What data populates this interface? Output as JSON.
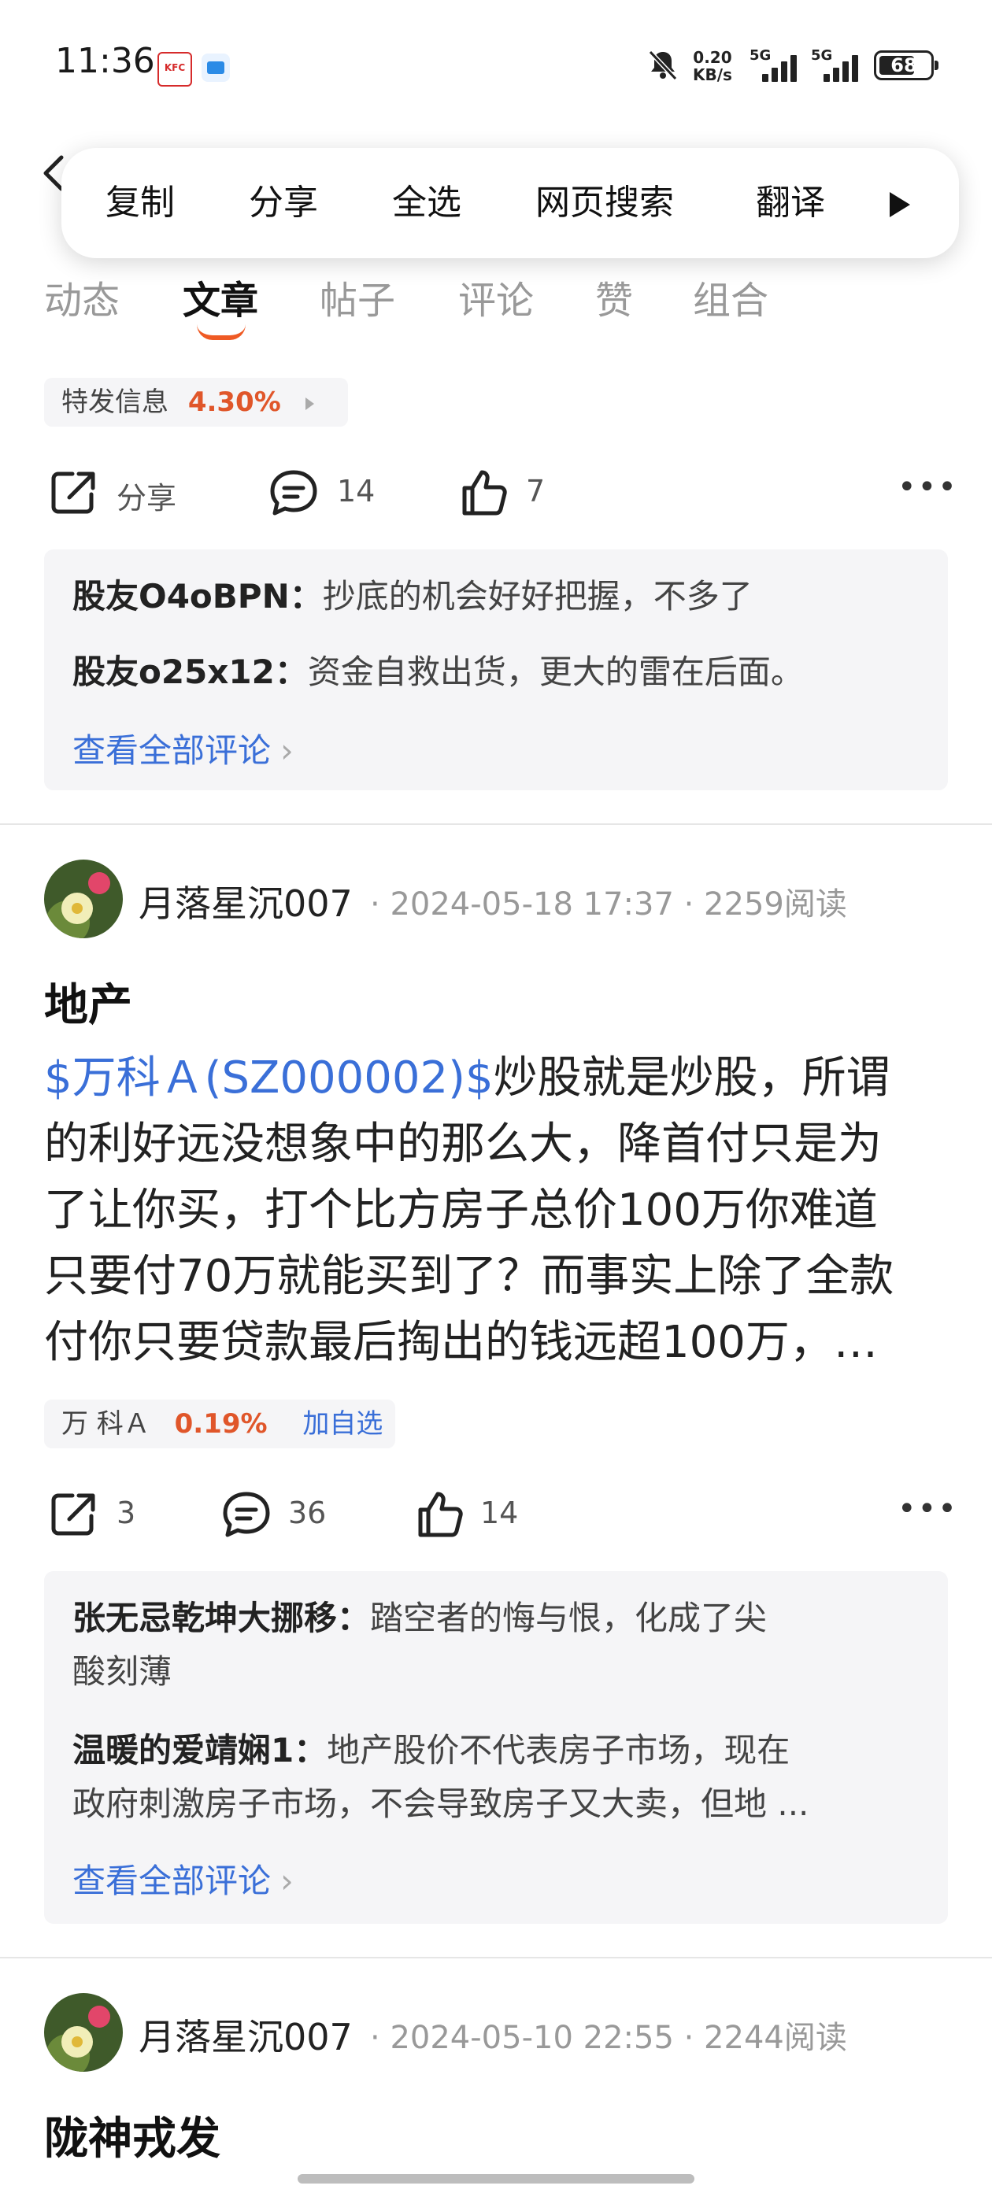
{
  "status_bar": {
    "time": "11:36",
    "kfc_label": "KFC",
    "net_speed_value": "0.20",
    "net_speed_unit": "KB/s",
    "signal1_label": "5G",
    "signal2_label": "5G",
    "battery": "68"
  },
  "context_menu": {
    "items": [
      "复制",
      "分享",
      "全选",
      "网页搜索",
      "翻译"
    ]
  },
  "tabs": [
    "动态",
    "文章",
    "帖子",
    "评论",
    "赞",
    "组合"
  ],
  "post1": {
    "stock_chip": {
      "name": "特发信息",
      "change": "4.30%"
    },
    "actions": {
      "share": "分享",
      "comments": "14",
      "likes": "7"
    },
    "comments": [
      {
        "user": "股友O4oBPN：",
        "text": "抄底的机会好好把握，不多了"
      },
      {
        "user": "股友o25x12：",
        "text": "资金自救出货，更大的雷在后面。"
      }
    ],
    "see_all": "查看全部评论"
  },
  "post2": {
    "author": "月落星沉007",
    "date": "2024-05-18 17:37",
    "reads": "2259阅读",
    "title": "地产",
    "stock_tag": "$万科Ａ(SZ000002)$",
    "body_lines": [
      "炒股就是炒股，所谓",
      "的利好远没想象中的那么大，降首付只是为",
      "了让你买，打个比方房子总价100万你难道",
      "只要付70万就能买到了？而事实上除了全款",
      "付你只要贷款最后掏出的钱远超100万，…"
    ],
    "stock_chip": {
      "name": "万 科Ａ",
      "change": "0.19%",
      "add": "加自选"
    },
    "actions": {
      "shares": "3",
      "comments": "36",
      "likes": "14"
    },
    "comments": [
      {
        "user": "张无忌乾坤大挪移：",
        "line1": "踏空者的悔与恨，化成了尖",
        "line2": "酸刻薄"
      },
      {
        "user": "温暖的爱靖娴1：",
        "line1": "地产股价不代表房子市场，现在",
        "line2": "政府刺激房子市场，不会导致房子又大卖，但地 ..."
      }
    ],
    "see_all": "查看全部评论"
  },
  "post3": {
    "author": "月落星沉007",
    "date": "2024-05-10 22:55",
    "reads": "2244阅读",
    "title": "陇神戎发"
  }
}
